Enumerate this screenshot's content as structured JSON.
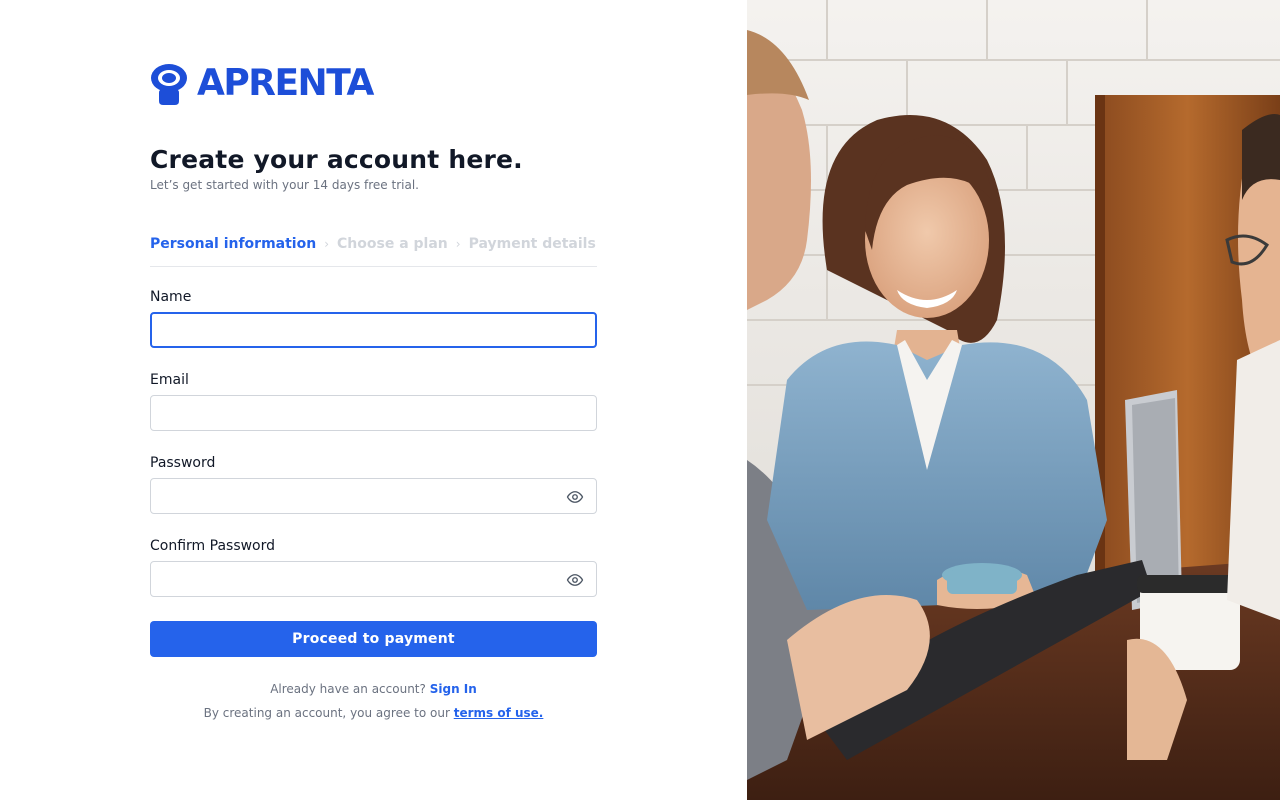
{
  "brand": {
    "name": "APRENTA",
    "color": "#1d4ed8"
  },
  "header": {
    "title": "Create your account here.",
    "subtitle": "Let’s get started with your 14 days free trial."
  },
  "steps": [
    {
      "label": "Personal information",
      "active": true
    },
    {
      "label": "Choose a plan",
      "active": false
    },
    {
      "label": "Payment details",
      "active": false
    }
  ],
  "form": {
    "name_label": "Name",
    "name_value": "",
    "email_label": "Email",
    "email_value": "",
    "password_label": "Password",
    "password_value": "",
    "confirm_label": "Confirm Password",
    "confirm_value": "",
    "submit_label": "Proceed to payment"
  },
  "footer": {
    "signin_prompt": "Already have an account?",
    "signin_link": "Sign In",
    "terms_prompt": "By creating an account, you agree to our",
    "terms_link": "terms of use."
  },
  "colors": {
    "accent": "#2563eb",
    "muted": "#6b7280",
    "inactive_step": "#d1d5db"
  },
  "icons": {
    "logo": "person-bulb-logo-icon",
    "password_toggle": "eye-icon",
    "step_separator": "chevron-right-icon"
  }
}
